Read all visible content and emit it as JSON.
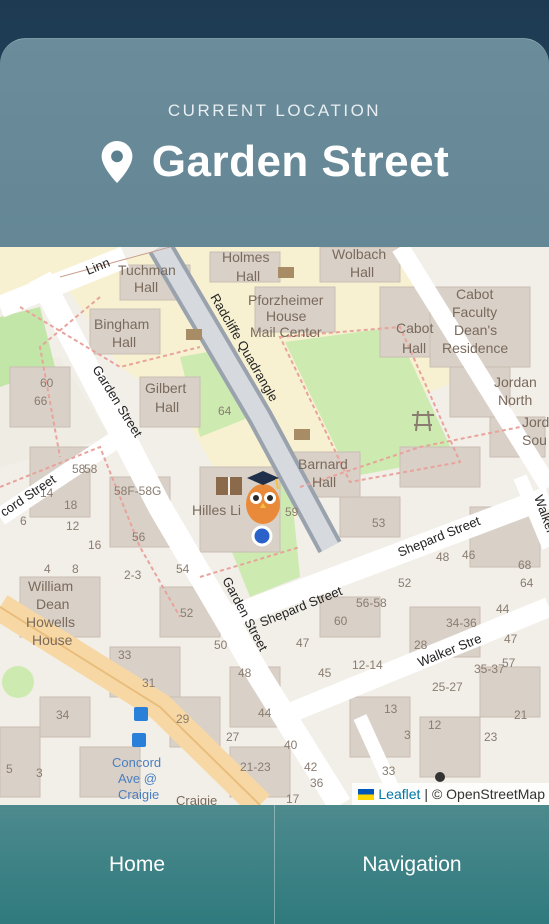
{
  "header": {
    "label": "CURRENT LOCATION",
    "location_name": "Garden Street",
    "pin_icon": "map-pin-icon"
  },
  "map": {
    "buildings": [
      "Tuchman Hall",
      "Holmes Hall",
      "Wolbach Hall",
      "Bingham Hall",
      "Pforzheimer House Mail Center",
      "Cabot Hall",
      "Cabot Faculty Dean's Residence",
      "Gilbert Hall",
      "Barnard Hall",
      "Hilles Library",
      "William Dean Howells House",
      "Jordan North",
      "Jordan South"
    ],
    "streets": [
      "Garden Street",
      "Linnaean Street",
      "Radcliffe Quadrangle",
      "Shepard Street",
      "Walker Street",
      "Concord Avenue",
      "Craigie"
    ],
    "stop": "Concord Ave @ Craigie",
    "numbers": [
      "60",
      "66",
      "58",
      "14",
      "18",
      "12",
      "58F-58G",
      "56",
      "16",
      "4",
      "6",
      "8",
      "2-3",
      "54",
      "52",
      "50",
      "48",
      "44",
      "40",
      "42",
      "36",
      "33",
      "31",
      "29",
      "27",
      "21-23",
      "17",
      "34",
      "5",
      "3",
      "53",
      "47",
      "56-58",
      "60",
      "52",
      "46",
      "48",
      "68",
      "64",
      "44",
      "34-36",
      "28",
      "25-27",
      "35-37",
      "45",
      "12-14",
      "13",
      "3",
      "12",
      "21",
      "23",
      "33",
      "47",
      "57",
      "59"
    ],
    "marker": "owl-mascot-marker",
    "attribution_leaflet": "Leaflet",
    "attribution_rest": "| © OpenStreetMap"
  },
  "nav": {
    "home_label": "Home",
    "navigation_label": "Navigation"
  },
  "colors": {
    "accent": "#4f7686",
    "nav_bg": "#357e80",
    "map_bg": "#f2efe9"
  }
}
